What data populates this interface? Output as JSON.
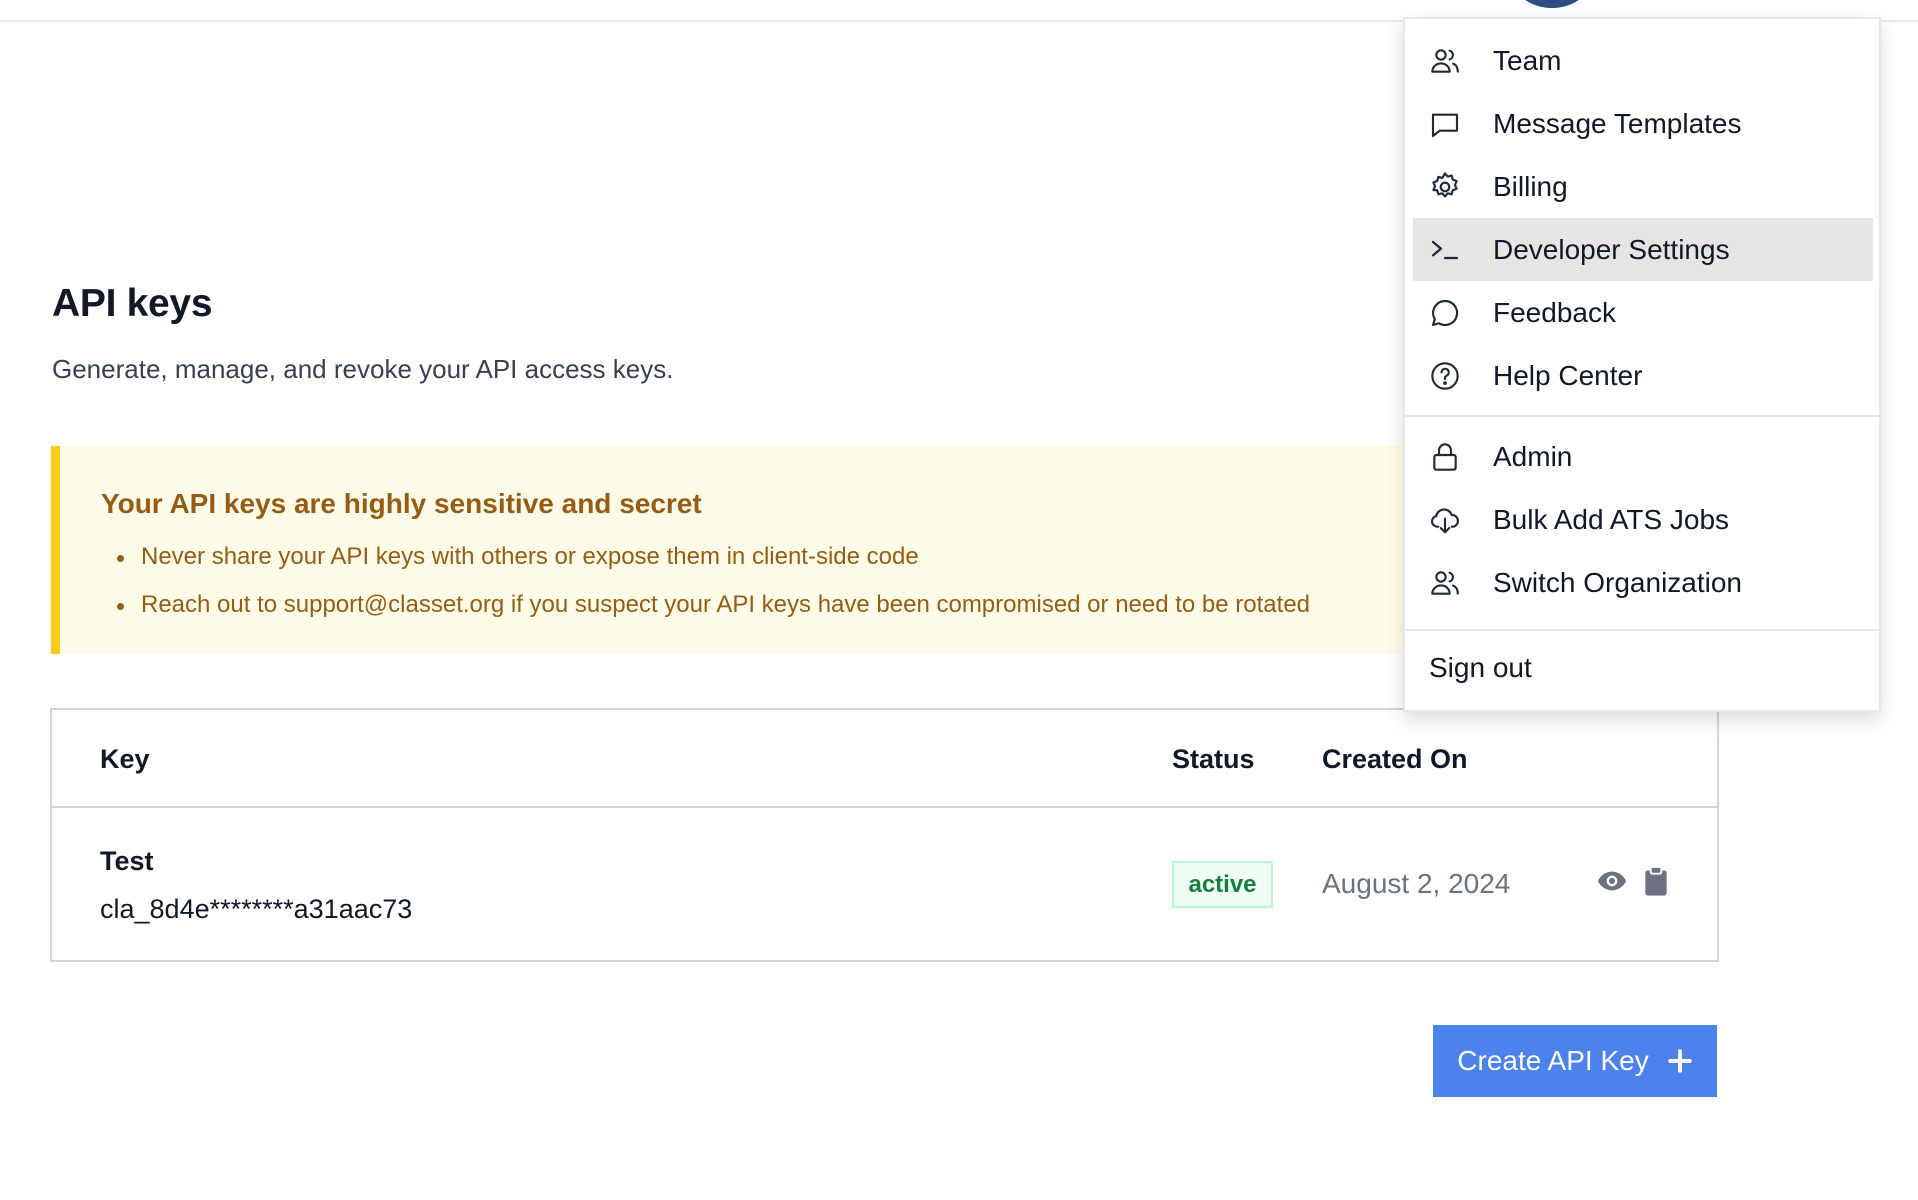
{
  "header": {
    "avatar_icon": "user-avatar-icon"
  },
  "main": {
    "title": "API keys",
    "subtitle": "Generate, manage, and revoke your API access keys."
  },
  "warning": {
    "title": "Your API keys are highly sensitive and secret",
    "items": [
      "Never share your API keys with others or expose them in client-side code",
      "Reach out to support@classet.org if you suspect your API keys have been compromised or need to be rotated"
    ]
  },
  "table": {
    "columns": [
      "Key",
      "Status",
      "Created On"
    ],
    "rows": [
      {
        "name": "Test",
        "key": "cla_8d4e********a31aac73",
        "status": "active",
        "created": "August 2, 2024",
        "actions": [
          "eye-icon",
          "clipboard-icon"
        ]
      }
    ]
  },
  "create_button": {
    "label": "Create API Key",
    "icon": "plus-icon"
  },
  "menu": {
    "items": [
      {
        "label": "Team",
        "icon": "users-icon"
      },
      {
        "label": "Message Templates",
        "icon": "message-square-icon"
      },
      {
        "label": "Billing",
        "icon": "gear-icon"
      },
      {
        "label": "Developer Settings",
        "icon": "terminal-icon",
        "active": true
      },
      {
        "label": "Feedback",
        "icon": "chat-bubble-icon"
      },
      {
        "label": "Help Center",
        "icon": "help-circle-icon"
      },
      {
        "label": "Admin",
        "icon": "lock-icon"
      },
      {
        "label": "Bulk Add ATS Jobs",
        "icon": "cloud-download-icon"
      },
      {
        "label": "Switch Organization",
        "icon": "users-icon"
      }
    ],
    "signout": "Sign out"
  },
  "colors": {
    "accent": "#4b82ec",
    "warning_bg": "#fefce8",
    "warning_border": "#facc15",
    "warning_text": "#965c14",
    "status_active": "#15803d",
    "menu_active_bg": "#e7e5e4"
  }
}
